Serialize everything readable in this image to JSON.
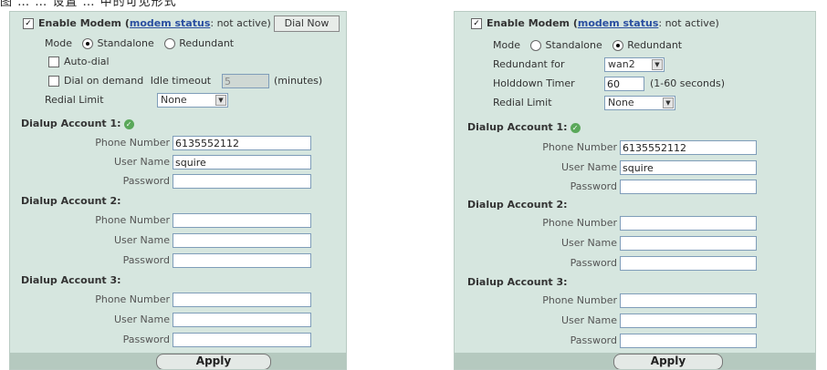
{
  "caption": "图 …  …  设置  …  中的可见形式",
  "left": {
    "enable_modem_label": "Enable Modem (",
    "modem_status_link": "modem status",
    "modem_status_value": ": not active)",
    "dial_now_button": "Dial Now",
    "mode_label": "Mode",
    "mode_standalone": "Standalone",
    "mode_redundant": "Redundant",
    "auto_dial": "Auto-dial",
    "dial_on_demand": "Dial on demand",
    "idle_timeout_label": "Idle timeout",
    "idle_timeout_value": "5",
    "idle_timeout_unit": "(minutes)",
    "redial_limit_label": "Redial Limit",
    "redial_limit_value": "None",
    "accounts": [
      {
        "title": "Dialup Account 1:",
        "phone_label": "Phone Number",
        "phone": "6135552112",
        "user_label": "User Name",
        "user": "squire",
        "pass_label": "Password",
        "pass": ""
      },
      {
        "title": "Dialup Account 2:",
        "phone_label": "Phone Number",
        "phone": "",
        "user_label": "User Name",
        "user": "",
        "pass_label": "Password",
        "pass": ""
      },
      {
        "title": "Dialup Account 3:",
        "phone_label": "Phone Number",
        "phone": "",
        "user_label": "User Name",
        "user": "",
        "pass_label": "Password",
        "pass": ""
      }
    ],
    "apply_button": "Apply"
  },
  "right": {
    "enable_modem_label": "Enable Modem (",
    "modem_status_link": "modem status",
    "modem_status_value": ": not active)",
    "mode_label": "Mode",
    "mode_standalone": "Standalone",
    "mode_redundant": "Redundant",
    "redundant_for_label": "Redundant for",
    "redundant_for_value": "wan2",
    "holddown_label": "Holddown Timer",
    "holddown_value": "60",
    "holddown_unit": "(1-60 seconds)",
    "redial_limit_label": "Redial Limit",
    "redial_limit_value": "None",
    "accounts": [
      {
        "title": "Dialup Account 1:",
        "phone_label": "Phone Number",
        "phone": "6135552112",
        "user_label": "User Name",
        "user": "squire",
        "pass_label": "Password",
        "pass": ""
      },
      {
        "title": "Dialup Account 2:",
        "phone_label": "Phone Number",
        "phone": "",
        "user_label": "User Name",
        "user": "",
        "pass_label": "Password",
        "pass": ""
      },
      {
        "title": "Dialup Account 3:",
        "phone_label": "Phone Number",
        "phone": "",
        "user_label": "User Name",
        "user": "",
        "pass_label": "Password",
        "pass": ""
      }
    ],
    "apply_button": "Apply"
  },
  "colors": {
    "panel_bg": "#d6e6df",
    "footer_bg": "#b5c9bf",
    "link": "#2a4fa0"
  }
}
